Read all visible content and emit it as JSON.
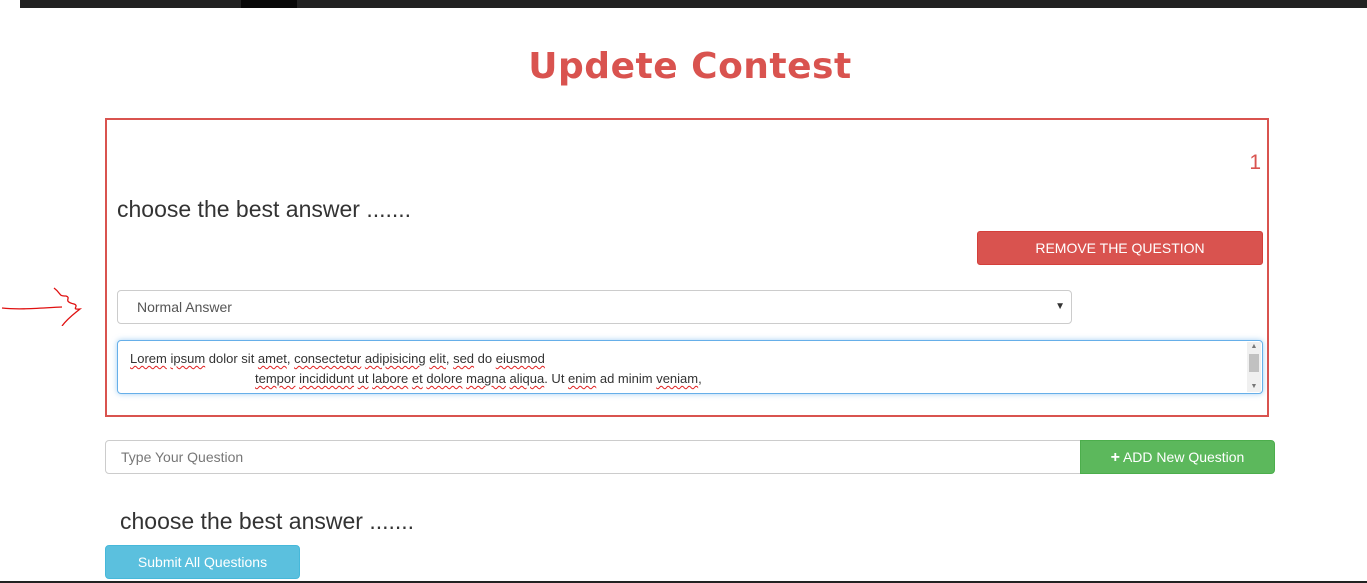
{
  "page": {
    "title": "Updete Contest"
  },
  "question_card": {
    "number": "1",
    "text": "choose the best answer .......",
    "remove_button": "REMOVE THE QUESTION",
    "answer_type": {
      "selected": "Normal Answer"
    },
    "answer_text": {
      "line1": [
        "Lorem",
        " ",
        "ipsum",
        " dolor sit ",
        "amet",
        ", ",
        "consectetur",
        " ",
        "adipisicing",
        " ",
        "elit",
        ", ",
        "sed",
        " do ",
        "eiusmod"
      ],
      "line2": [
        "tempor",
        " ",
        "incididunt",
        " ",
        "ut",
        " ",
        "labore",
        " ",
        "et",
        " ",
        "dolore",
        " ",
        "magna",
        " ",
        "aliqua",
        ". Ut ",
        "enim",
        " ad minim ",
        "veniam",
        ","
      ]
    }
  },
  "new_question": {
    "placeholder": "Type Your Question",
    "add_button": "ADD New Question"
  },
  "second_question": {
    "text": "choose the best answer ......."
  },
  "submit_button": "Submit All Questions",
  "colors": {
    "danger": "#d9534f",
    "success": "#5cb85c",
    "info": "#5bc0de",
    "annotation": "#e01010"
  },
  "icons": {
    "select_arrow": "chevron-down-icon",
    "add": "plus-icon",
    "annotation": "hand-drawn-arrow-icon"
  }
}
